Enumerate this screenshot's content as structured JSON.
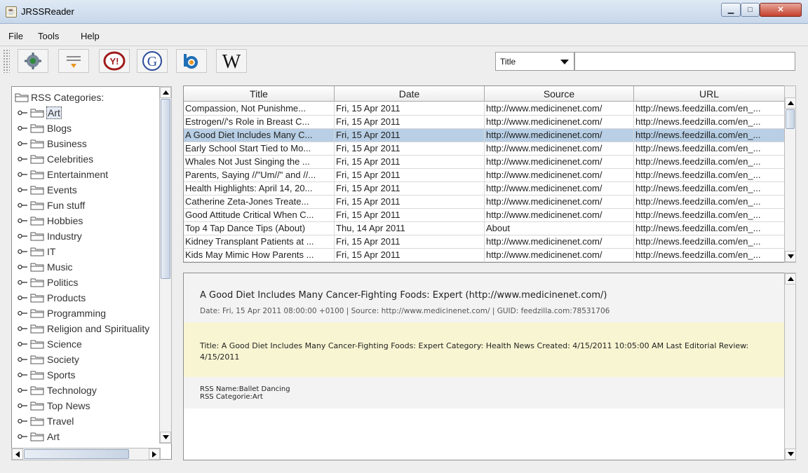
{
  "window": {
    "title": "JRSSReader"
  },
  "menu": [
    "File",
    "Tools",
    "Help"
  ],
  "toolbar": {
    "buttons": [
      "settings-icon",
      "rss-feed-icon",
      "yahoo-icon",
      "google-icon",
      "bing-icon",
      "wikipedia-icon"
    ],
    "search_field_select": "Title",
    "search_query": ""
  },
  "tree": {
    "root": "RSS Categories:",
    "items": [
      "Art",
      "Blogs",
      "Business",
      "Celebrities",
      "Entertainment",
      "Events",
      "Fun stuff",
      "Hobbies",
      "Industry",
      "IT",
      "Music",
      "Politics",
      "Products",
      "Programming",
      "Religion and Spirituality",
      "Science",
      "Society",
      "Sports",
      "Technology",
      "Top News",
      "Travel",
      "Art"
    ],
    "selected_index": 0
  },
  "table": {
    "columns": [
      "Title",
      "Date",
      "Source",
      "URL"
    ],
    "rows": [
      [
        "Compassion, Not Punishme...",
        "Fri, 15 Apr 2011",
        "http://www.medicinenet.com/",
        "http://news.feedzilla.com/en_..."
      ],
      [
        "Estrogen//'s Role in Breast C...",
        "Fri, 15 Apr 2011",
        "http://www.medicinenet.com/",
        "http://news.feedzilla.com/en_..."
      ],
      [
        "A Good Diet Includes Many C...",
        "Fri, 15 Apr 2011",
        "http://www.medicinenet.com/",
        "http://news.feedzilla.com/en_..."
      ],
      [
        "Early School Start Tied to Mo...",
        "Fri, 15 Apr 2011",
        "http://www.medicinenet.com/",
        "http://news.feedzilla.com/en_..."
      ],
      [
        "Whales Not Just Singing the ...",
        "Fri, 15 Apr 2011",
        "http://www.medicinenet.com/",
        "http://news.feedzilla.com/en_..."
      ],
      [
        "Parents, Saying //\"Um//\" and //...",
        "Fri, 15 Apr 2011",
        "http://www.medicinenet.com/",
        "http://news.feedzilla.com/en_..."
      ],
      [
        "Health Highlights: April 14, 20...",
        "Fri, 15 Apr 2011",
        "http://www.medicinenet.com/",
        "http://news.feedzilla.com/en_..."
      ],
      [
        "Catherine Zeta-Jones Treate...",
        "Fri, 15 Apr 2011",
        "http://www.medicinenet.com/",
        "http://news.feedzilla.com/en_..."
      ],
      [
        "Good Attitude Critical When C...",
        "Fri, 15 Apr 2011",
        "http://www.medicinenet.com/",
        "http://news.feedzilla.com/en_..."
      ],
      [
        "Top 4 Tap Dance Tips (About)",
        "Thu, 14 Apr 2011",
        "About",
        "http://news.feedzilla.com/en_..."
      ],
      [
        "Kidney Transplant Patients at ...",
        "Fri, 15 Apr 2011",
        "http://www.medicinenet.com/",
        "http://news.feedzilla.com/en_..."
      ],
      [
        "Kids May Mimic How Parents ...",
        "Fri, 15 Apr 2011",
        "http://www.medicinenet.com/",
        "http://news.feedzilla.com/en_..."
      ]
    ],
    "selected_index": 2
  },
  "detail": {
    "title": "A Good Diet Includes Many Cancer-Fighting Foods: Expert (http://www.medicinenet.com/)",
    "meta": "Date:  Fri, 15 Apr 2011 08:00:00 +0100  |  Source:  http://www.medicinenet.com/  |  GUID:  feedzilla.com:78531706",
    "description": "Title: A Good Diet Includes Many Cancer-Fighting Foods: Expert Category: Health News Created: 4/15/2011 10:05:00 AM Last Editorial Review: 4/15/2011",
    "rss_name": "RSS Name:Ballet Dancing",
    "rss_category": "RSS Categorie:Art"
  }
}
